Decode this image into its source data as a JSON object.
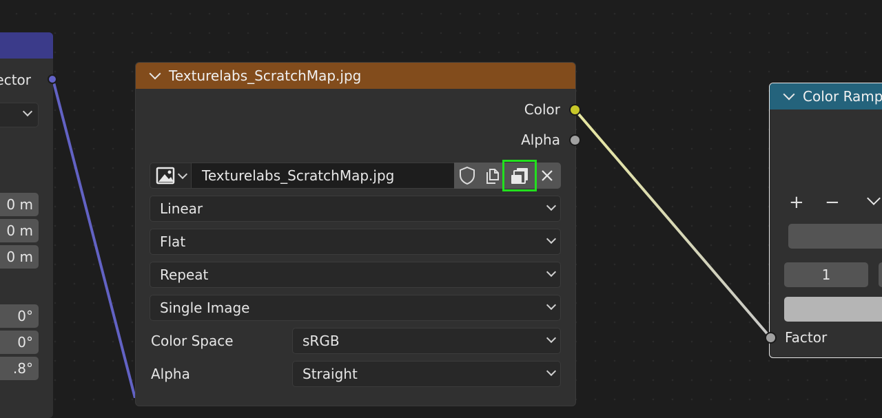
{
  "left_node": {
    "output_label": "Vector",
    "field_1": "0 m",
    "field_2": "0 m",
    "field_3": "0 m",
    "field_4": "0°",
    "field_5": "0°",
    "field_6": ".8°"
  },
  "image_node": {
    "title": "Texturelabs_ScratchMap.jpg",
    "outputs": {
      "color": "Color",
      "alpha": "Alpha"
    },
    "image_name": "Texturelabs_ScratchMap.jpg",
    "interpolation": "Linear",
    "projection": "Flat",
    "extension": "Repeat",
    "source": "Single Image",
    "color_space_label": "Color Space",
    "color_space_value": "sRGB",
    "alpha_label": "Alpha",
    "alpha_value": "Straight"
  },
  "ramp_node": {
    "title": "Color Ramp",
    "add_button": "+",
    "remove_button": "−",
    "stop_index": "1",
    "input_label": "Factor"
  },
  "colors": {
    "image_header": "#824c1c",
    "left_header": "#3b3b8a",
    "ramp_header": "#24637c",
    "color_socket": "#c7c729",
    "gray_socket": "#a1a1a1",
    "vector_socket": "#6363c7",
    "highlight": "#22e01e"
  },
  "icons": [
    "image-type-icon",
    "shield-icon",
    "duplicate-icon",
    "pack-image-icon",
    "close-icon",
    "chevron-down-icon"
  ]
}
